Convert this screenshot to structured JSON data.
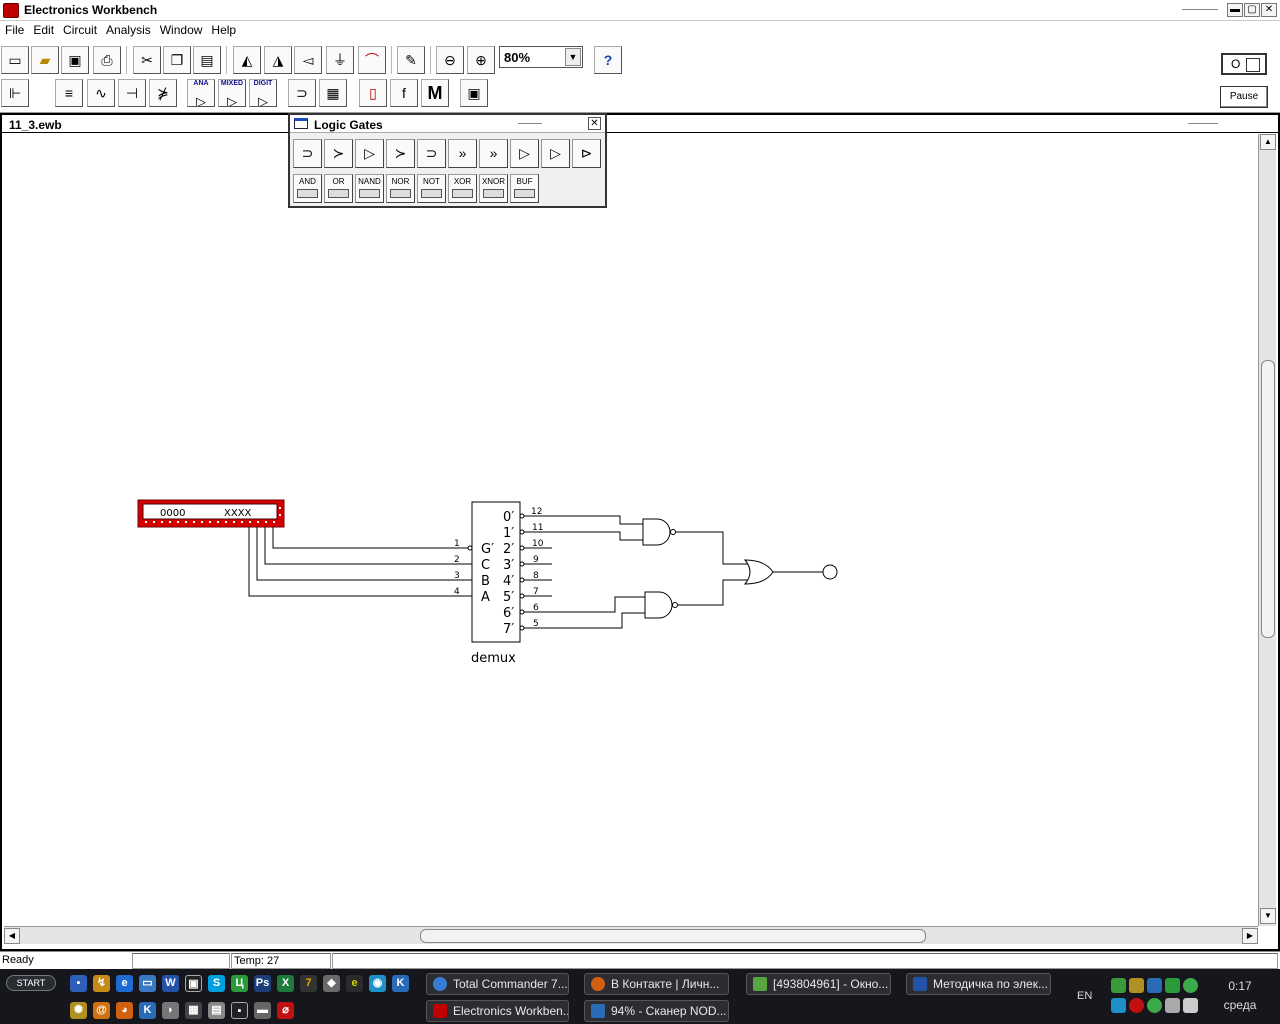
{
  "app": {
    "title": "Electronics Workbench"
  },
  "menu": [
    "File",
    "Edit",
    "Circuit",
    "Analysis",
    "Window",
    "Help"
  ],
  "toolbar": {
    "zoom_value": "80%",
    "help_label": "?",
    "power_label": "O",
    "pause_label": "Pause",
    "bin_labels": {
      "analog": "ANA",
      "mixed": "MIXED",
      "digital": "DIGIT"
    },
    "misc_label": "M",
    "func_label": "f"
  },
  "document": {
    "title": "11_3.ewb"
  },
  "palette": {
    "title": "Logic Gates",
    "close": "✕",
    "gates": [
      "AND",
      "OR",
      "NAND",
      "NOR",
      "NOT",
      "XOR",
      "XNOR",
      "BUF"
    ]
  },
  "circuit": {
    "word_generator": {
      "left_value": "0000",
      "right_value": "XXXX"
    },
    "demux": {
      "label": "demux",
      "inputs": [
        {
          "name": "G′",
          "pin": "1"
        },
        {
          "name": "C",
          "pin": "2"
        },
        {
          "name": "B",
          "pin": "3"
        },
        {
          "name": "A",
          "pin": "4"
        }
      ],
      "outputs": [
        {
          "name": "0′",
          "pin": "12"
        },
        {
          "name": "1′",
          "pin": "11"
        },
        {
          "name": "2′",
          "pin": "10"
        },
        {
          "name": "3′",
          "pin": "9"
        },
        {
          "name": "4′",
          "pin": "8"
        },
        {
          "name": "5′",
          "pin": "7"
        },
        {
          "name": "6′",
          "pin": "6"
        },
        {
          "name": "7′",
          "pin": "5"
        }
      ]
    }
  },
  "status": {
    "ready": "Ready",
    "temp": "Temp:  27"
  },
  "taskbar": {
    "start": "START",
    "tasks": [
      "Total Commander 7....",
      "В Контакте | Личн...",
      "[493804961] - Окно...",
      "Методичка по элек...",
      "Electronics Workben...",
      "94% - Сканер NOD..."
    ],
    "lang": "EN",
    "clock": "0:17",
    "day": "среда"
  }
}
